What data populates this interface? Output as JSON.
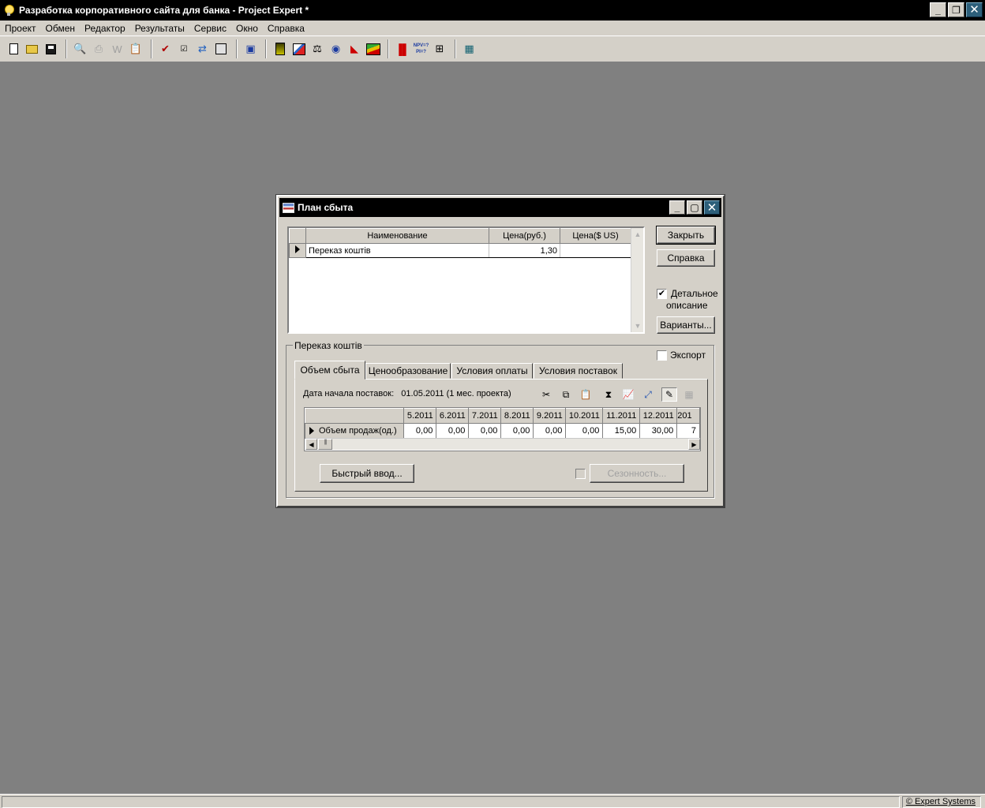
{
  "window": {
    "title": "Разработка корпоративного сайта для банка - Project Expert *",
    "btn_minimize": "_",
    "btn_restore": "❐",
    "btn_close": "✕"
  },
  "menu": [
    "Проект",
    "Обмен",
    "Редактор",
    "Результаты",
    "Сервис",
    "Окно",
    "Справка"
  ],
  "toolbar_icons": [
    "new-doc-icon",
    "open-folder-icon",
    "save-icon",
    "preview-icon",
    "print-icon",
    "word-export-icon",
    "clipboard-icon",
    "check-icon",
    "checklist-icon",
    "link-icon",
    "notes-icon",
    "monitor-icon",
    "stock-icon",
    "cashflow-chart-icon",
    "scales-icon",
    "globe-icon",
    "chart-icon",
    "area-chart-icon",
    "bar-chart-icon",
    "npv-pi-icon",
    "tree-icon",
    "calculator-icon"
  ],
  "toolbar_labels": {
    "npv": "NPV=?",
    "pi": "PI=?"
  },
  "dialog": {
    "title": "План сбыта",
    "buttons": {
      "close": "Закрыть",
      "help": "Справка",
      "variants": "Варианты..."
    },
    "detailed_label_1": "Детальное",
    "detailed_label_2": "описание",
    "detailed_checked": true,
    "export_label": "Экспорт",
    "export_checked": false,
    "products_grid": {
      "columns": [
        "Наименование",
        "Цена(руб.)",
        "Цена($ US)"
      ],
      "rows": [
        {
          "name": "Переказ коштів",
          "price_rub": "1,30",
          "price_usd": ""
        }
      ]
    },
    "group_label": "Переказ коштів",
    "tabs": [
      "Объем сбыта",
      "Ценообразование",
      "Условия оплаты",
      "Условия поставок"
    ],
    "active_tab": "Объем сбыта",
    "start_date_label": "Дата начала поставок:",
    "start_date_value": "01.05.2011 (1 мес. проекта)",
    "volume_grid": {
      "columns": [
        "5.2011",
        "6.2011",
        "7.2011",
        "8.2011",
        "9.2011",
        "10.2011",
        "11.2011",
        "12.2011",
        "201"
      ],
      "row_label": "Объем продаж(од.)",
      "values": [
        "0,00",
        "0,00",
        "0,00",
        "0,00",
        "0,00",
        "0,00",
        "15,00",
        "30,00",
        "7"
      ]
    },
    "quick_input": "Быстрый ввод...",
    "seasonality": "Сезонность...",
    "seasonality_checked": false
  },
  "status": {
    "credit": "© Expert Systems"
  }
}
